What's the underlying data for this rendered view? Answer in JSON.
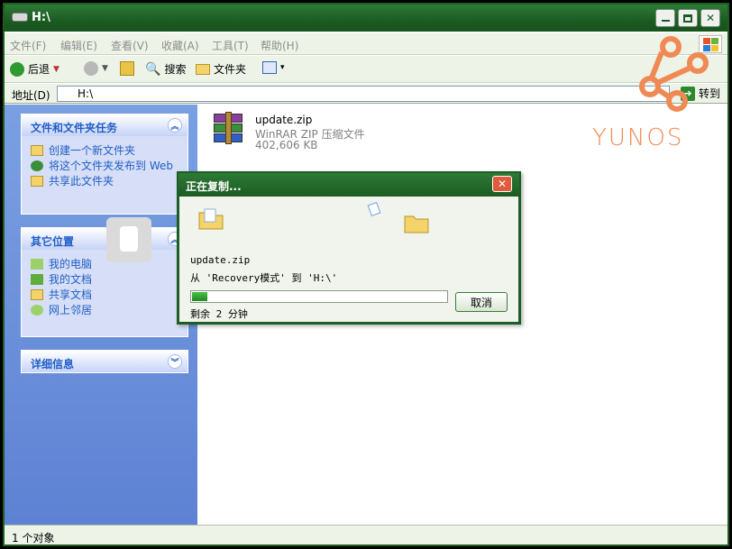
{
  "window": {
    "title": "H:\\",
    "min": "0",
    "max": "1",
    "close": "r"
  },
  "menu": [
    "文件(F)",
    "编辑(E)",
    "查看(V)",
    "收藏(A)",
    "工具(T)",
    "帮助(H)"
  ],
  "toolbar": {
    "back": "后退",
    "search": "搜索",
    "folders": "文件夹"
  },
  "address": {
    "label": "地址(D)",
    "value": "H:\\",
    "go": "转到"
  },
  "tasks_panel": {
    "title": "文件和文件夹任务",
    "items": [
      "创建一个新文件夹",
      "将这个文件夹发布到 Web",
      "共享此文件夹"
    ]
  },
  "places_panel": {
    "title": "其它位置",
    "items": [
      "我的电脑",
      "我的文档",
      "共享文档",
      "网上邻居"
    ]
  },
  "details_panel": {
    "title": "详细信息"
  },
  "file": {
    "name": "update.zip",
    "type": "WinRAR ZIP 压缩文件",
    "size": "402,606 KB"
  },
  "brand": {
    "word": "YUNOS"
  },
  "dialog": {
    "title": "正在复制...",
    "filename": "update.zip",
    "from_to": "从 'Recovery模式' 到 'H:\\'",
    "remaining": "剩余 2 分钟",
    "cancel": "取消",
    "progress": 0.06
  },
  "status": {
    "text": "1 个对象"
  },
  "colors": {
    "title_green": "#1b5b22",
    "brand_orange": "#ef8a55",
    "pane_blue": "#6b8fdb"
  }
}
